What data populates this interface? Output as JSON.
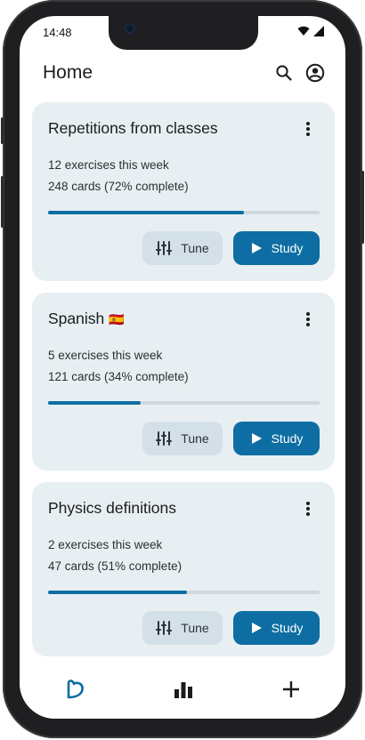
{
  "status_bar": {
    "time": "14:48",
    "icons": [
      "wifi-icon",
      "signal-icon"
    ]
  },
  "app_bar": {
    "title": "Home",
    "icons": [
      "search-icon",
      "account-icon"
    ]
  },
  "decks": [
    {
      "title": "Repetitions from classes",
      "exercises": "12 exercises this week",
      "cards": "248 cards (72% complete)",
      "progress": 0.72,
      "tune_label": "Tune",
      "study_label": "Study"
    },
    {
      "title": "Spanish",
      "flag": "🇪🇸",
      "exercises": "5 exercises this week",
      "cards": "121 cards (34% complete)",
      "progress": 0.34,
      "tune_label": "Tune",
      "study_label": "Study"
    },
    {
      "title": "Physics definitions",
      "exercises": "2 exercises this week",
      "cards": "47 cards (51% complete)",
      "progress": 0.51,
      "tune_label": "Tune",
      "study_label": "Study"
    }
  ],
  "bottom_nav": {
    "items": [
      "home-icon",
      "stats-icon",
      "add-icon"
    ],
    "active": "home-icon"
  },
  "colors": {
    "accent": "#0e6ea3",
    "card_bg": "#e8eff2",
    "tune_bg": "#d3e0e8"
  }
}
